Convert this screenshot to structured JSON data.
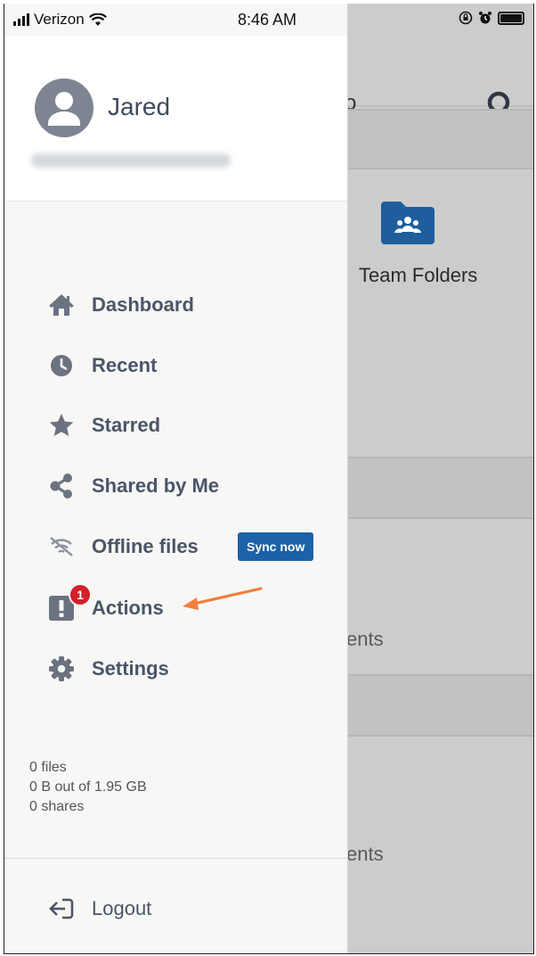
{
  "status_bar": {
    "carrier": "Verizon",
    "time": "8:46 AM"
  },
  "background": {
    "title_fragment": "o",
    "folder_label": "Team Folders",
    "row_fragment_1": "ents",
    "row_fragment_2": "ents"
  },
  "profile": {
    "name": "Jared"
  },
  "menu": {
    "items": [
      {
        "label": "Dashboard",
        "icon": "home-icon"
      },
      {
        "label": "Recent",
        "icon": "clock-icon"
      },
      {
        "label": "Starred",
        "icon": "star-icon"
      },
      {
        "label": "Shared by Me",
        "icon": "share-icon"
      },
      {
        "label": "Offline files",
        "icon": "offline-wifi-icon"
      },
      {
        "label": "Actions",
        "icon": "exclamation-icon",
        "badge": "1"
      },
      {
        "label": "Settings",
        "icon": "gear-icon"
      }
    ],
    "sync_button": "Sync now"
  },
  "stats": {
    "files": "0 files",
    "storage": "0 B out of 1.95 GB",
    "shares": "0 shares"
  },
  "logout": {
    "label": "Logout",
    "icon": "logout-icon"
  },
  "colors": {
    "accent": "#1b62a8",
    "badge": "#d3202a",
    "icon": "#6b7280",
    "label": "#4a5568",
    "arrow": "#f07e3c"
  }
}
